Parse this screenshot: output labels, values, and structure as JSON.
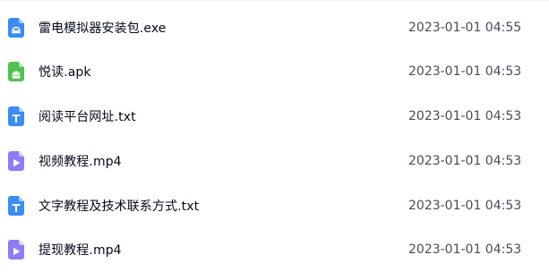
{
  "files": [
    {
      "name": "雷电模拟器安装包.exe",
      "time": "2023-01-01 04:55",
      "icon": "exe-icon",
      "color": "#3a8cf5"
    },
    {
      "name": "悦读.apk",
      "time": "2023-01-01 04:53",
      "icon": "apk-icon",
      "color": "#52c152"
    },
    {
      "name": "阅读平台网址.txt",
      "time": "2023-01-01 04:53",
      "icon": "txt-icon",
      "color": "#3a8cf5"
    },
    {
      "name": "视频教程.mp4",
      "time": "2023-01-01 04:53",
      "icon": "video-icon",
      "color": "#8c7cf7"
    },
    {
      "name": "文字教程及技术联系方式.txt",
      "time": "2023-01-01 04:53",
      "icon": "txt-icon",
      "color": "#3a8cf5"
    },
    {
      "name": "提现教程.mp4",
      "time": "2023-01-01 04:53",
      "icon": "video-icon",
      "color": "#8c7cf7"
    }
  ]
}
